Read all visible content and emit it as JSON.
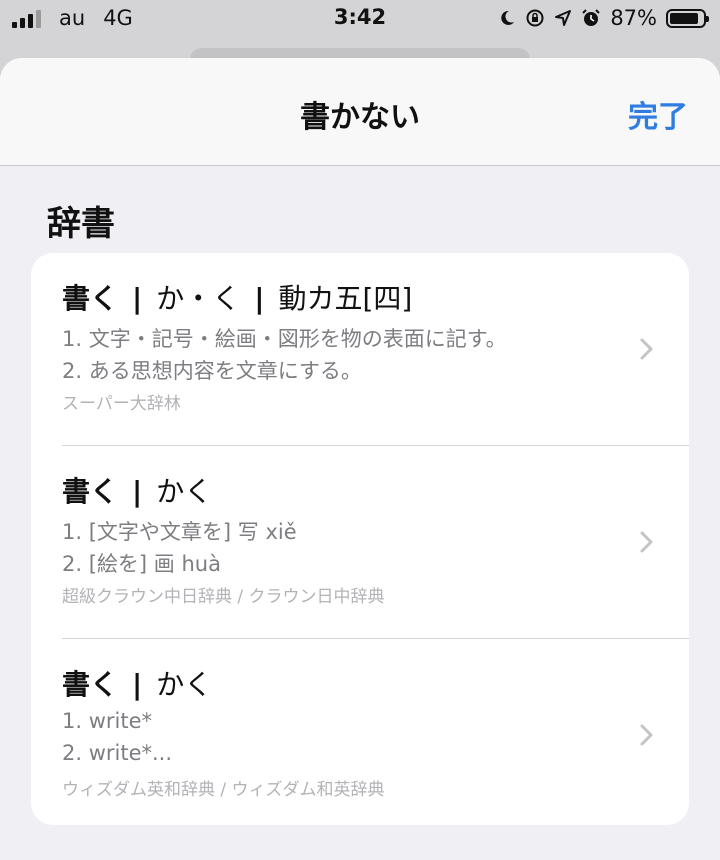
{
  "status_bar": {
    "carrier": "au",
    "network": "4G",
    "time": "3:42",
    "battery_text": "87%",
    "battery_level": 0.87,
    "icons": [
      "signal-icon",
      "moon-icon",
      "rotation-lock-icon",
      "location-icon",
      "alarm-icon",
      "battery-icon"
    ]
  },
  "nav": {
    "title": "書かない",
    "done_label": "完了"
  },
  "section": {
    "title": "辞書"
  },
  "entries": [
    {
      "headword": "書く",
      "parts": [
        "か・く",
        "動カ五[四]"
      ],
      "lines": [
        "1. 文字・記号・絵画・図形を物の表面に記す。",
        "2. ある思想内容を文章にする。"
      ],
      "source": "スーパー大辞林"
    },
    {
      "headword": "書く",
      "parts": [
        "かく"
      ],
      "lines": [
        "1. [文字や文章を] 写 xiě",
        "2. [絵を] 画 huà"
      ],
      "source": "超級クラウン中日辞典 / クラウン日中辞典"
    },
    {
      "headword": "書く",
      "parts": [
        "かく"
      ],
      "lines": [
        "1. write*",
        "2. write*..."
      ],
      "source": "ウィズダム英和辞典 / ウィズダム和英辞典"
    }
  ],
  "colors": {
    "accent": "#2f7de1",
    "sheet_background": "#efeff4",
    "secondary_text": "#7d7d82",
    "tertiary_text": "#b3b3b7"
  }
}
